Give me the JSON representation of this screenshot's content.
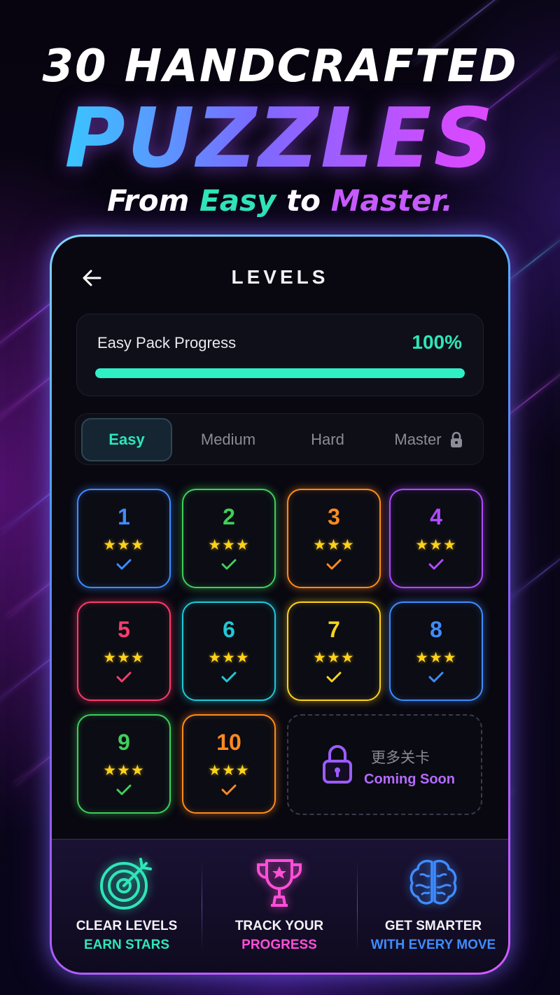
{
  "hero": {
    "line1": "30 HANDCRAFTED",
    "line2": "PUZZLES",
    "line3_part1": "From ",
    "line3_easy": "Easy",
    "line3_part2": " to ",
    "line3_master": "Master."
  },
  "header": {
    "back_icon": "arrow-left-icon",
    "title": "LEVELS"
  },
  "progress": {
    "label": "Easy Pack Progress",
    "percent_text": "100%",
    "value": 1.0,
    "color": "#2ee6b8"
  },
  "tabs": [
    {
      "label": "Easy",
      "active": true
    },
    {
      "label": "Medium",
      "active": false
    },
    {
      "label": "Hard",
      "active": false
    },
    {
      "label": "Master",
      "active": false,
      "locked": true,
      "icon": "lock-icon"
    }
  ],
  "levels": [
    {
      "number": "1",
      "stars": "★★★",
      "color": "#3f8cff",
      "completed": true
    },
    {
      "number": "2",
      "stars": "★★★",
      "color": "#3fcf5a",
      "completed": true
    },
    {
      "number": "3",
      "stars": "★★★",
      "color": "#ff8a1e",
      "completed": true
    },
    {
      "number": "4",
      "stars": "★★★",
      "color": "#b04cff",
      "completed": true
    },
    {
      "number": "5",
      "stars": "★★★",
      "color": "#ff3b6b",
      "completed": true
    },
    {
      "number": "6",
      "stars": "★★★",
      "color": "#22c8d6",
      "completed": true
    },
    {
      "number": "7",
      "stars": "★★★",
      "color": "#ffd21a",
      "completed": true
    },
    {
      "number": "8",
      "stars": "★★★",
      "color": "#3f8cff",
      "completed": true
    },
    {
      "number": "9",
      "stars": "★★★",
      "color": "#3fcf5a",
      "completed": true
    },
    {
      "number": "10",
      "stars": "★★★",
      "color": "#ff8a1e",
      "completed": true
    }
  ],
  "coming_soon": {
    "title_cn": "更多关卡",
    "label": "Coming Soon",
    "icon": "lock-icon"
  },
  "features": [
    {
      "icon": "target-icon",
      "line1": "CLEAR LEVELS",
      "line2": "EARN STARS",
      "color": "#2ee6b8"
    },
    {
      "icon": "trophy-icon",
      "line1": "TRACK YOUR",
      "line2": "PROGRESS",
      "color": "#ff4fd8"
    },
    {
      "icon": "brain-icon",
      "line1": "GET SMARTER",
      "line2": "WITH EVERY MOVE",
      "color": "#3f8cff"
    }
  ]
}
